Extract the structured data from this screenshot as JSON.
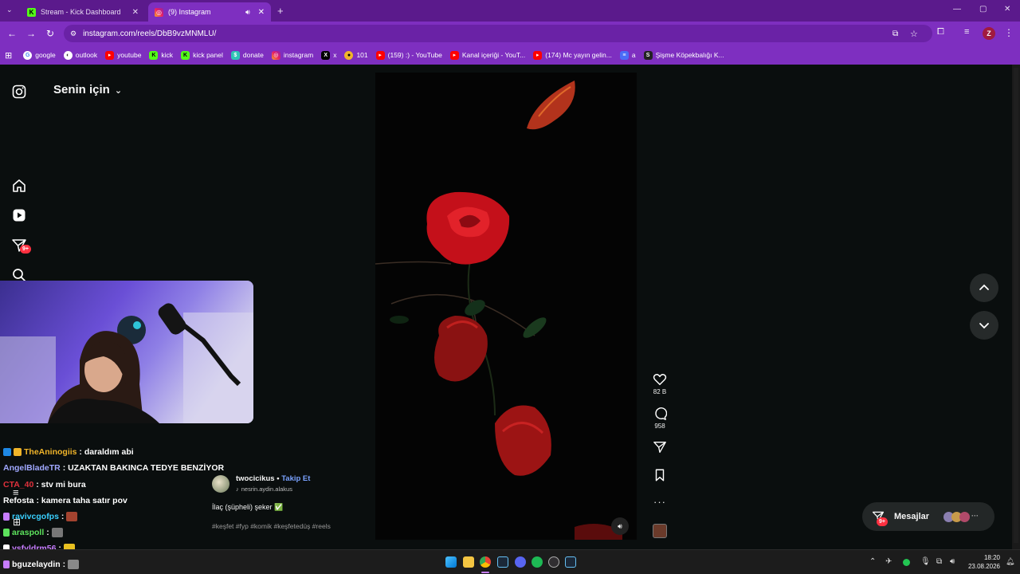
{
  "tabs": [
    {
      "title": "Stream - Kick Dashboard",
      "favicon": "kick-icon"
    },
    {
      "title": "(9) Instagram",
      "favicon": "instagram-icon"
    }
  ],
  "url": "instagram.com/reels/DbB9vzMNMLU/",
  "bookmarks": [
    {
      "label": "google"
    },
    {
      "label": "outlook"
    },
    {
      "label": "youtube"
    },
    {
      "label": "kick"
    },
    {
      "label": "kick panel"
    },
    {
      "label": "donate"
    },
    {
      "label": "instagram"
    },
    {
      "label": "x"
    },
    {
      "label": "101"
    },
    {
      "label": "(159) :) - YouTube"
    },
    {
      "label": "Kanal içeriği - YouT..."
    },
    {
      "label": "(174) Mc yayın gelin..."
    },
    {
      "label": "a"
    },
    {
      "label": "Şişme Köpekbalığı K..."
    }
  ],
  "profile_initial": "Z",
  "sidebar": {
    "feed_title": "Senin için",
    "notif_badge": "9+"
  },
  "reel": {
    "likes": "82 B",
    "comments": "958",
    "username": "twocicikus",
    "follow": "Takip Et",
    "audio": "nesrin.aydin.alakus",
    "caption": "İlaç (şüpheli) şeker ✅",
    "tags": "#keşfet #fyp #komik #keşfetedüş #reels"
  },
  "messages": {
    "label": "Mesajlar",
    "badge": "9+"
  },
  "chat": [
    {
      "user": "TheAninogiis",
      "text": ": daraldım abi",
      "color": "#f0b429"
    },
    {
      "user": "AngelBladeTR",
      "text": ": UZAKTAN BAKINCA TEDYE BENZİYOR",
      "color": "#a0a8ff"
    },
    {
      "user": "CTA_40",
      "text": ": stv mi bura",
      "color": "#e0313c"
    },
    {
      "user": "Refosta",
      "text": ": kamera taha satır pov",
      "color": "#ffffff"
    },
    {
      "user": "ravivcgofps",
      "text": ":",
      "color": "#39d0ff"
    },
    {
      "user": "araspoll",
      "text": ":",
      "color": "#5de35d"
    },
    {
      "user": "ysfyldrm56",
      "text": ":",
      "color": "#c77dff"
    },
    {
      "user": "bguzelaydin",
      "text": ":",
      "color": "#ffffff"
    }
  ],
  "clock": {
    "time": "18:20",
    "date": "23.08.2026"
  },
  "colors": {
    "accent": "#7e2fc0",
    "tab_bar": "#5b1a8c",
    "badge": "#ff3040",
    "link": "#7aa2ff"
  }
}
